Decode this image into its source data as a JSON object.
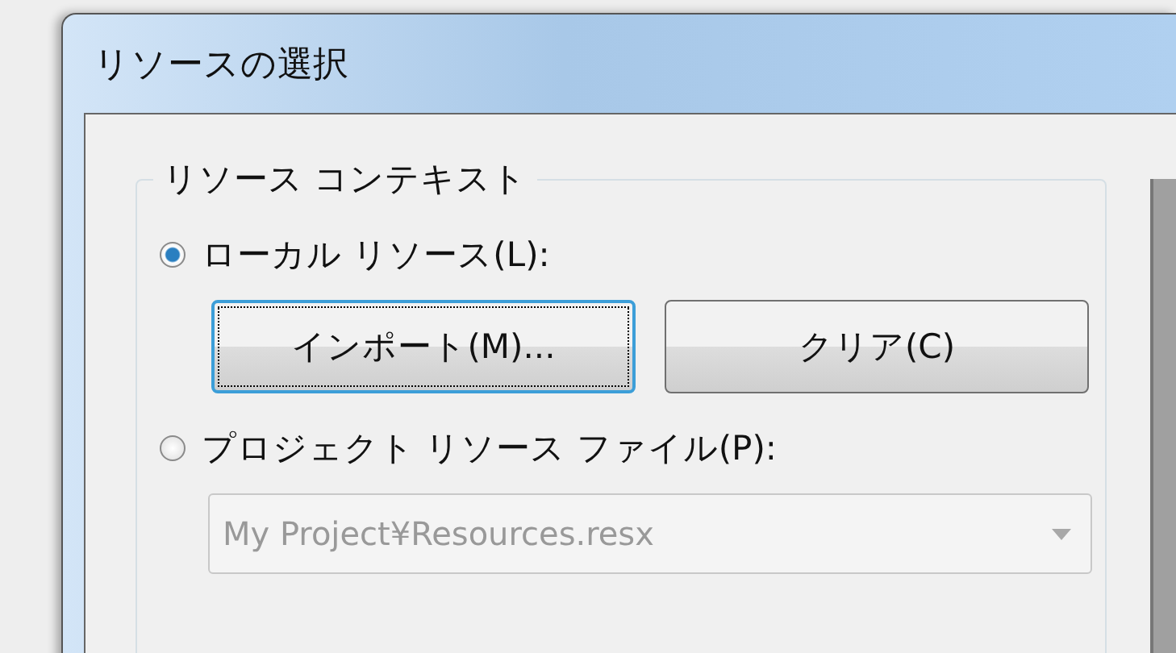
{
  "window": {
    "title": "リソースの選択"
  },
  "resource_context": {
    "label": "リソース コンテキスト",
    "local_option": {
      "label": "ローカル リソース(L):",
      "selected": true
    },
    "buttons": [
      {
        "label": "インポート(M)...",
        "focused": true
      },
      {
        "label": "クリア(C)",
        "focused": false
      }
    ],
    "project_option": {
      "label": "プロジェクト リソース ファイル(P):",
      "selected": false
    },
    "file_dropdown": {
      "value": "My Project¥Resources.resx",
      "disabled": true
    }
  }
}
